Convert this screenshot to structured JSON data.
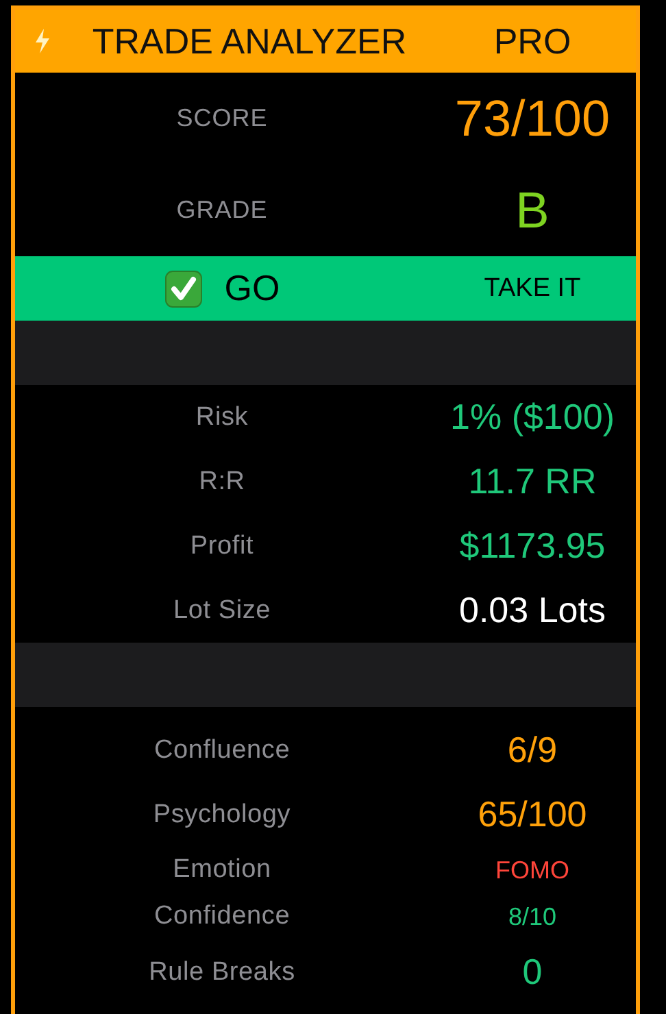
{
  "header": {
    "title": "TRADE ANALYZER",
    "badge": "PRO"
  },
  "summary": [
    {
      "label": "SCORE",
      "value": "73/100",
      "color": "#ff9f0a",
      "kind": "huge"
    },
    {
      "label": "GRADE",
      "value": "B",
      "color": "#7ed321",
      "kind": "huge"
    }
  ],
  "verdict": {
    "label": "GO",
    "action": "TAKE IT",
    "checked": true
  },
  "metrics": [
    {
      "label": "Risk",
      "value": "1% ($100)",
      "color": "#1fc87a",
      "kind": "large"
    },
    {
      "label": "R:R",
      "value": "11.7 RR",
      "color": "#1fc87a",
      "kind": "large"
    },
    {
      "label": "Profit",
      "value": "$1173.95",
      "color": "#1fc87a",
      "kind": "large"
    },
    {
      "label": "Lot Size",
      "value": "0.03 Lots",
      "color": "#ffffff",
      "kind": "large"
    }
  ],
  "psychology": [
    {
      "label": "Confluence",
      "value": "6/9",
      "color": "#ffa10a",
      "kind": "large"
    },
    {
      "label": "Psychology",
      "value": "65/100",
      "color": "#ffa10a",
      "kind": "large"
    },
    {
      "label": "Emotion",
      "value": "FOMO",
      "color": "#ff453a",
      "kind": "small"
    },
    {
      "label": "Confidence",
      "value": "8/10",
      "color": "#1fc87a",
      "kind": "small"
    },
    {
      "label": "Rule Breaks",
      "value": "0",
      "color": "#1fc87a",
      "kind": "large"
    }
  ]
}
